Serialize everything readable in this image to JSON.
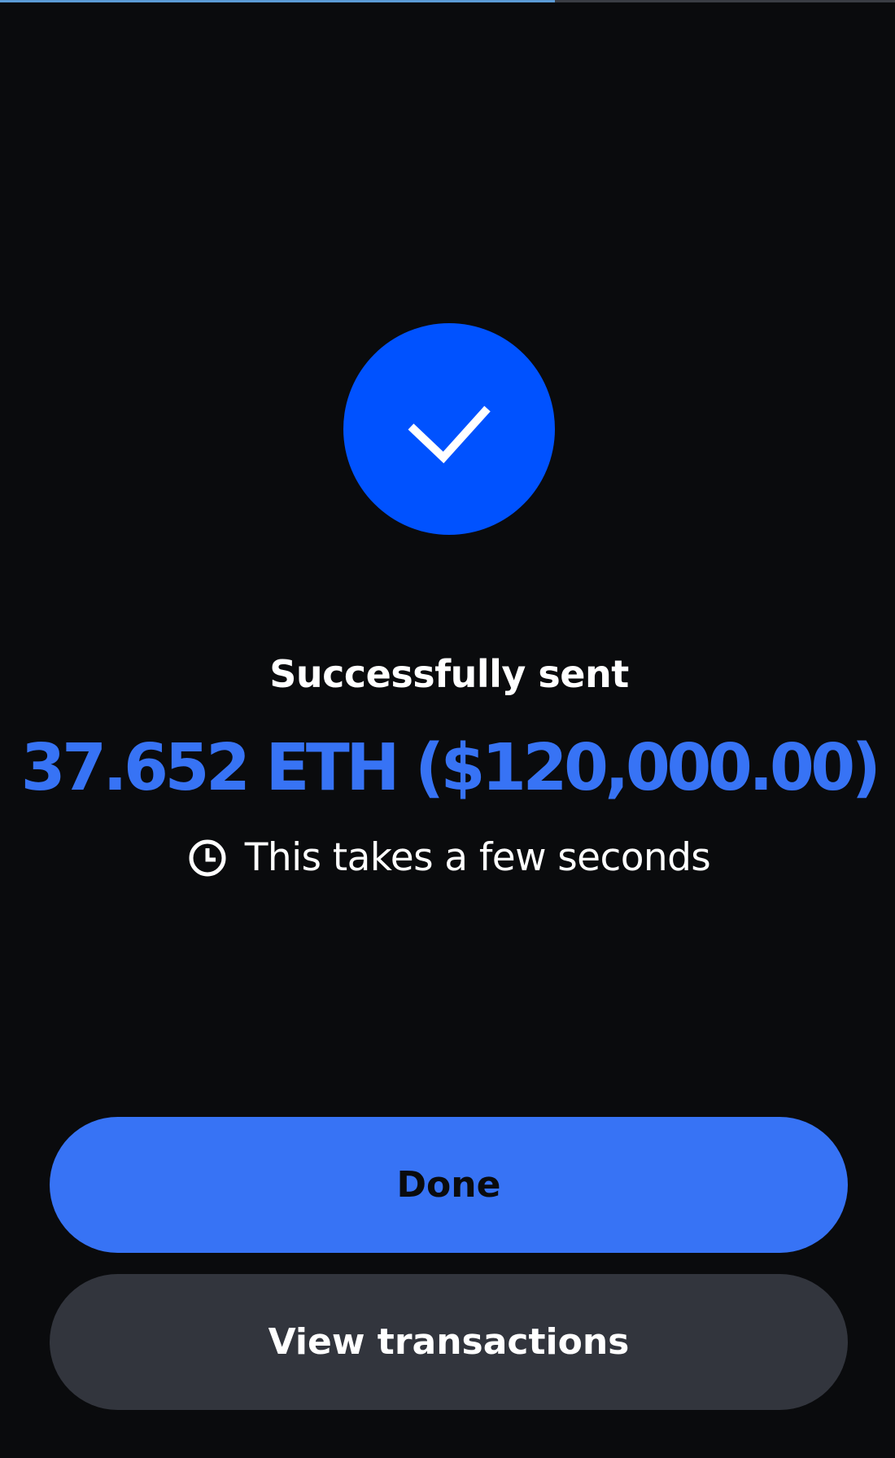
{
  "page": {
    "background_color": "#0a0b0d",
    "progress": {
      "value": 0.62,
      "color": "#5b9bd5",
      "track_color": "#3a3d44"
    }
  },
  "status": {
    "icon": "check-icon",
    "circle_color": "#0052ff",
    "title": "Successfully sent",
    "amount": "37.652 ETH ($120,000.00)",
    "amount_color": "#3773f5",
    "eta_icon": "clock-icon",
    "eta_text": "This takes a few seconds"
  },
  "actions": {
    "done_label": "Done",
    "done_color": "#3773f5",
    "view_transactions_label": "View transactions",
    "view_transactions_color": "#32353d"
  }
}
